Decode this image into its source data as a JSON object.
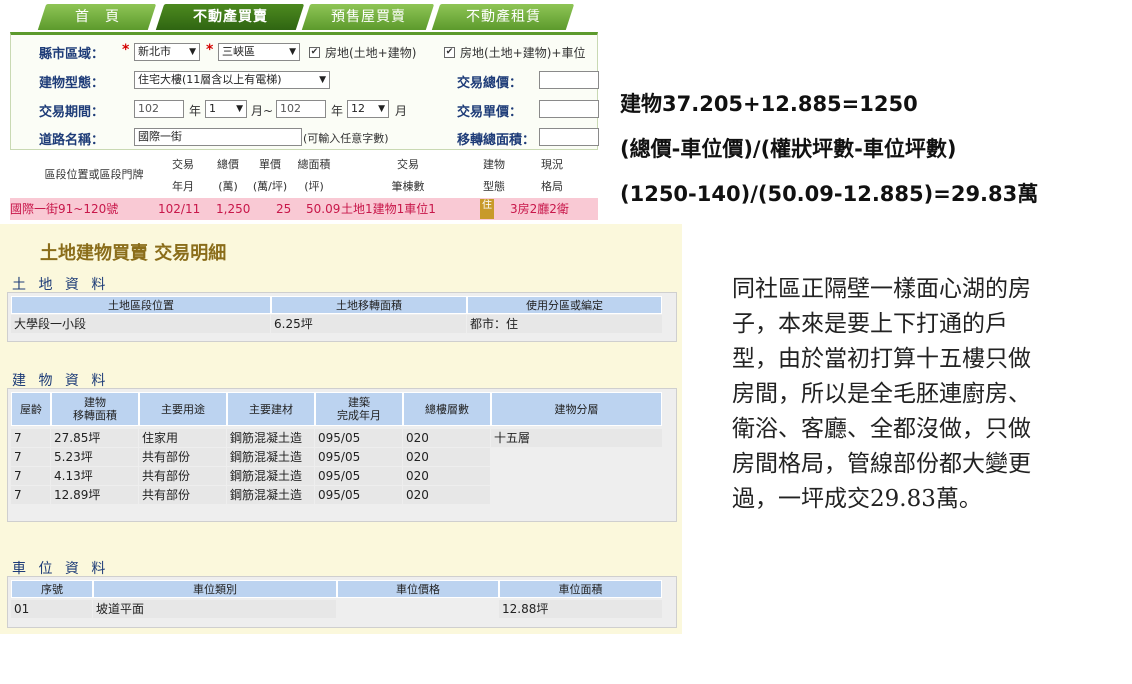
{
  "tabs": [
    "首　頁",
    "不動產買賣",
    "預售屋買賣",
    "不動產租賃"
  ],
  "form": {
    "region_label": "縣市區域：",
    "city": "新北市",
    "district": "三峽區",
    "check1": "房地(土地+建物)",
    "check2": "房地(土地+建物)+車位",
    "type_label": "建物型態：",
    "type_value": "住宅大樓(11層含以上有電梯)",
    "period_label": "交易期間：",
    "year_from": "102",
    "year_unit": "年",
    "month_from": "1",
    "month_unit_tilde": "月~",
    "year_to": "102",
    "month_to": "12",
    "month_unit": "月",
    "road_label": "道路名稱：",
    "road_value": "國際一街",
    "road_hint": "(可輸入任意字數)",
    "total_price_label": "交易總價：",
    "unit_price_label": "交易單價：",
    "area_label": "移轉總面積："
  },
  "results": {
    "headers": [
      {
        "l1": "區段位置或區段門牌",
        "l2": ""
      },
      {
        "l1": "交易",
        "l2": "年月"
      },
      {
        "l1": "總價",
        "l2": "(萬)"
      },
      {
        "l1": "單價",
        "l2": "(萬/坪)"
      },
      {
        "l1": "總面積",
        "l2": "(坪)"
      },
      {
        "l1": "交易",
        "l2": "筆棟數"
      },
      {
        "l1": "建物",
        "l2": "型態"
      },
      {
        "l1": "現況",
        "l2": "格局"
      }
    ],
    "row": {
      "addr": "國際一街91~120號",
      "ym": "102/11",
      "total": "1,250",
      "unit": "25",
      "area": "50.09",
      "count": "土地1建物1車位1",
      "type": "住",
      "layout": "3房2廳2衛"
    }
  },
  "detail": {
    "title": "土地建物買賣 交易明細",
    "land_title": "土 地 資 料",
    "land_headers": [
      "土地區段位置",
      "土地移轉面積",
      "使用分區或編定"
    ],
    "land_row": [
      "大學段一小段",
      "6.25坪",
      "都市：住"
    ],
    "bldg_title": "建 物 資 料",
    "bldg_headers": [
      "屋齡",
      "建物\n移轉面積",
      "主要用途",
      "主要建材",
      "建築\n完成年月",
      "總樓層數",
      "建物分層"
    ],
    "bldg_rows": [
      [
        "7",
        "27.85坪",
        "住家用",
        "鋼筋混凝土造",
        "095/05",
        "020",
        "十五層"
      ],
      [
        "7",
        "5.23坪",
        "共有部份",
        "鋼筋混凝土造",
        "095/05",
        "020",
        ""
      ],
      [
        "7",
        "4.13坪",
        "共有部份",
        "鋼筋混凝土造",
        "095/05",
        "020",
        ""
      ],
      [
        "7",
        "12.89坪",
        "共有部份",
        "鋼筋混凝土造",
        "095/05",
        "020",
        ""
      ]
    ],
    "park_title": "車 位 資 料",
    "park_headers": [
      "序號",
      "車位類別",
      "車位價格",
      "車位面積"
    ],
    "park_row": [
      "01",
      "坡道平面",
      "",
      "12.88坪"
    ]
  },
  "annotation": {
    "eq1": "建物37.205+12.885=1250",
    "eq2": "(總價-車位價)/(權狀坪數-車位坪數)",
    "eq3": "(1250-140)/(50.09-12.885)=29.83萬",
    "note_lines": [
      "同社區正隔壁一樣面心湖的房",
      "子，本來是要上下打通的戶",
      "型，由於當初打算十五樓只做",
      "房間，所以是全毛胚連廚房、",
      "衛浴、客廳、全都沒做，只做",
      "房間格局，管線部份都大變更",
      "過，一坪成交29.83萬。"
    ]
  },
  "colors": {
    "tab_green": "#5c9a2c",
    "label_blue": "#1e3c78",
    "row_pink": "#f9c9d4",
    "row_text": "#c8174a",
    "detail_bg": "#fbf8dc",
    "header_blue": "#bcd3f0",
    "title_gold": "#8a6d1a"
  }
}
